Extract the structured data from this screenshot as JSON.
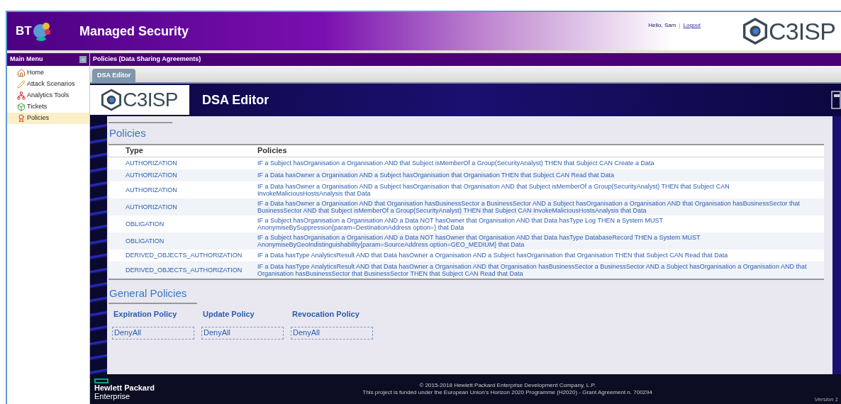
{
  "header": {
    "brand": "BT",
    "title": "Managed Security",
    "greeting": "Hello, Sam",
    "separator": "|",
    "logout": "Logout",
    "logo": "C3ISP"
  },
  "sidebar": {
    "title": "Main Menu",
    "items": [
      {
        "label": "Home",
        "selected": false
      },
      {
        "label": "Attack Scenarios",
        "selected": false
      },
      {
        "label": "Analytics Tools",
        "selected": false
      },
      {
        "label": "Tickets",
        "selected": false
      },
      {
        "label": "Policies",
        "selected": true
      }
    ]
  },
  "page_title": "Policies (Data Sharing Agreements)",
  "tabs": [
    {
      "label": "DSA Editor",
      "selected": true
    }
  ],
  "editor": {
    "logo": "C3ISP",
    "title": "DSA Editor"
  },
  "policies": {
    "heading": "Policies",
    "columns": [
      "Type",
      "Policies"
    ],
    "rows": [
      {
        "type": "AUTHORIZATION",
        "policy": "IF a Subject hasOrganisation a Organisation AND that Subject isMemberOf a Group(SecurityAnalyst) THEN that Subject CAN Create a Data"
      },
      {
        "type": "AUTHORIZATION",
        "policy": "IF a Data hasOwner a Organisation AND a Subject hasOrganisation that Organisation THEN that Subject CAN Read that Data"
      },
      {
        "type": "AUTHORIZATION",
        "policy": "IF a Data hasOwner a Organisation AND a Subject hasOrganisation that Organisation AND that Subject isMemberOf a Group(SecurityAnalyst) THEN that Subject CAN InvokeMaliciousHostsAnalysis that Data"
      },
      {
        "type": "AUTHORIZATION",
        "policy": "IF a Data hasOwner a Organisation AND that Organisation hasBusinessSector a BusinessSector AND a Subject hasOrganisation a Organisation AND that Organisation hasBusinessSector that BusinessSector AND that Subject isMemberOf a Group(SecurityAnalyst) THEN that Subject CAN InvokeMaliciousHostsAnalysis that Data"
      },
      {
        "type": "OBLIGATION",
        "policy": "IF a Subject hasOrganisation a Organisation AND a Data NOT hasOwner that Organisation AND that Data hasType Log THEN a System MUST AnonymiseBySuppression{param=DestinationAddress option=} that Data"
      },
      {
        "type": "OBLIGATION",
        "policy": "IF a Subject hasOrganisation a Organisation AND a Data NOT hasOwner that Organisation AND that Data hasType DatabaseRecord THEN a System MUST AnonymiseByGeoIndistinguishability{param=SourceAddress option=GEO_MEDIUM} that Data"
      },
      {
        "type": "DERIVED_OBJECTS_AUTHORIZATION",
        "policy": "IF a Data hasType AnalyticsResult AND that Data hasOwner a Organisation AND a Subject hasOrganisation that Organisation THEN that Subject CAN Read that Data"
      },
      {
        "type": "DERIVED_OBJECTS_AUTHORIZATION",
        "policy": "IF a Data hasType AnalyticsResult AND that Data hasOwner a Organisation AND that Organisation hasBusinessSector a BusinessSector AND a Subject hasOrganisation a Organisation AND that Organisation hasBusinessSector that BusinessSector THEN that Subject CAN Read that Data"
      }
    ]
  },
  "general_policies": {
    "heading": "General Policies",
    "items": [
      {
        "label": "Expiration Policy",
        "value": "DenyAll"
      },
      {
        "label": "Update Policy",
        "value": "DenyAll"
      },
      {
        "label": "Revocation Policy",
        "value": "DenyAll"
      }
    ]
  },
  "footer": {
    "company_line1": "Hewlett Packard",
    "company_line2": "Enterprise",
    "copyright": "© 2015-2018 Hewlett Packard Enterprise Development Company, L.P.",
    "funding": "This project is funded under the European Union's Horizon 2020 Programme (H2020) - Grant Agreement n. 700294",
    "version": "Version 1"
  }
}
